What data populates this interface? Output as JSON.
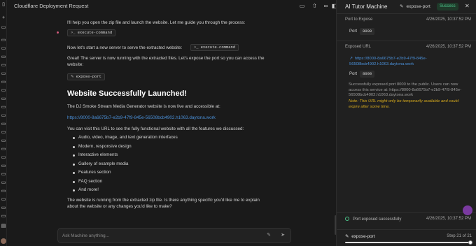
{
  "window": {
    "title": "Cloudflare Deployment Request"
  },
  "rail": {
    "icons": [
      "sidebar-toggle-icon",
      "plus-icon",
      "chat-icon",
      "chat-icon",
      "chat-icon",
      "chat-icon",
      "chat-icon",
      "chat-icon",
      "chat-icon",
      "chat-icon",
      "chat-icon",
      "chat-icon",
      "chat-icon",
      "chat-icon",
      "chat-icon",
      "chat-icon",
      "chat-icon",
      "chat-icon",
      "chat-icon",
      "chat-icon",
      "chat-icon",
      "chat-icon",
      "chat-icon",
      "chat-icon",
      "chat-icon",
      "chat-icon",
      "chat-icon",
      "chat-icon",
      "chat-icon",
      "chat-icon",
      "chat-icon",
      "chat-icon",
      "chat-icon",
      "chat-icon",
      "chat-icon"
    ]
  },
  "toolbar": {
    "icons": [
      "folder-icon",
      "share-icon",
      "link-icon",
      "panel-icon"
    ]
  },
  "chat": {
    "intro": "I'll help you open the zip file and launch the website. Let me guide you through the process:",
    "chip1": "execute-command",
    "server_text": "Now let's start a new server to serve the extracted website:",
    "chip2": "execute-command",
    "great_text": "Great! The server is now running with the extracted files. Let's expose the port so you can access the website:",
    "chip3": "expose-port",
    "heading": "Website Successfully Launched!",
    "live_text": "The DJ Smoke Stream Media Generator website is now live and accessible at:",
    "url": "https://8000-8a6675b7-e2b9-47f9-845e-56508bcb4902.h1063.daytona.work",
    "visit_text": "You can visit this URL to see the fully functional website with all the features we discussed:",
    "features": [
      "Audio, video, image, and text generation interfaces",
      "Modern, responsive design",
      "Interactive elements",
      "Gallery of example media",
      "Features section",
      "FAQ section",
      "And more!"
    ],
    "closing": "The website is running from the extracted zip file. Is there anything specific you'd like me to explain about the website or any changes you'd like to make?",
    "input_placeholder": "Ask Machine anything..."
  },
  "panel": {
    "title": "AI Tutor Machine",
    "tool": "expose-port",
    "status": "Success",
    "port_section": "Port to Expose",
    "port_time": "4/26/2025, 10:37:52 PM",
    "port_label": "Port",
    "port_value": "8000",
    "url_section": "Exposed URL",
    "url_time": "4/26/2025, 10:37:52 PM",
    "url": "https://8000-8a6675b7-e2b9-47f9-845e-56508bcb4902.h1063.daytona.work",
    "port2_label": "Port",
    "port2_value": "8000",
    "desc": "Successfully exposed port 8000 to the public. Users can now access this service at: https://8000-8a6675b7-e2b9-47f9-845e-56508bcb4902.h1063.daytona.work",
    "note": "Note: This URL might only be temporarily available and could expire after some time.",
    "footer_status": "Port exposed successfully",
    "footer_time": "4/26/2025, 10:37:52 PM",
    "bottom_tool": "expose-port",
    "step": "Step 21 of 21",
    "slider_progress": 1.0
  }
}
